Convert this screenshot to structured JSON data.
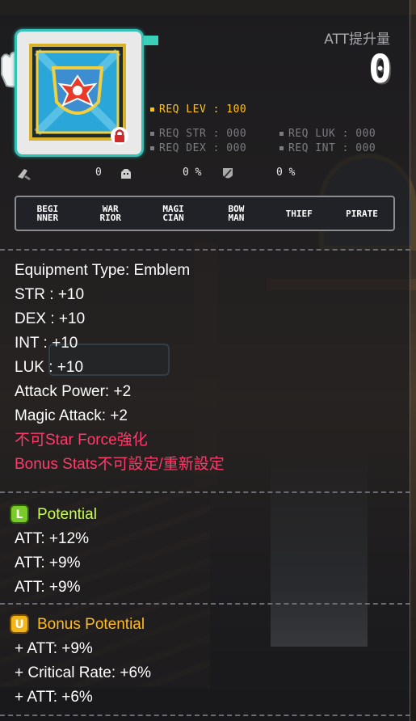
{
  "header": {
    "att_label": "ATT提升量",
    "att_value": "0"
  },
  "requirements": {
    "lev": "REQ LEV : 100",
    "str": "REQ STR : 000",
    "luk": "REQ LUK : 000",
    "dex": "REQ DEX : 000",
    "int": "REQ INT : 000"
  },
  "mini_stats": {
    "stat1": "0",
    "stat2": "0 %",
    "stat3": "0 %"
  },
  "jobs": [
    {
      "label": "BEGI\nNNER"
    },
    {
      "label": "WAR\nRIOR"
    },
    {
      "label": "MAGI\nCIAN"
    },
    {
      "label": "BOW\nMAN"
    },
    {
      "label": "THIEF"
    },
    {
      "label": "PIRATE"
    }
  ],
  "stats": {
    "equipment_type": "Equipment Type: Emblem",
    "str": "STR : +10",
    "dex": "DEX : +10",
    "int": "INT : +10",
    "luk": "LUK : +10",
    "attack_power": "Attack Power: +2",
    "magic_attack": "Magic Attack: +2",
    "no_star_force": "不可Star Force強化",
    "no_bonus_stats": "Bonus Stats不可設定/重新設定"
  },
  "potential": {
    "title": "Potential",
    "grade_letter": "L",
    "lines": [
      "ATT: +12%",
      "ATT: +9%",
      "ATT: +9%"
    ]
  },
  "bonus_potential": {
    "title": "Bonus Potential",
    "grade_letter": "U",
    "lines": [
      "+ ATT: +9%",
      "+ Critical Rate: +6%",
      "+ ATT: +6%"
    ]
  },
  "colors": {
    "frame": "#34c2b6",
    "req_level": "#ffc21a",
    "warning": "#ff3b6b",
    "legendary": "#c8ff4a",
    "unique": "#ffbb22"
  },
  "icons": [
    "emblem-item-icon",
    "lock-icon",
    "white-glove-icon",
    "att-icon",
    "boss-icon",
    "defense-ignore-icon",
    "legendary-grade-icon",
    "unique-grade-icon"
  ]
}
